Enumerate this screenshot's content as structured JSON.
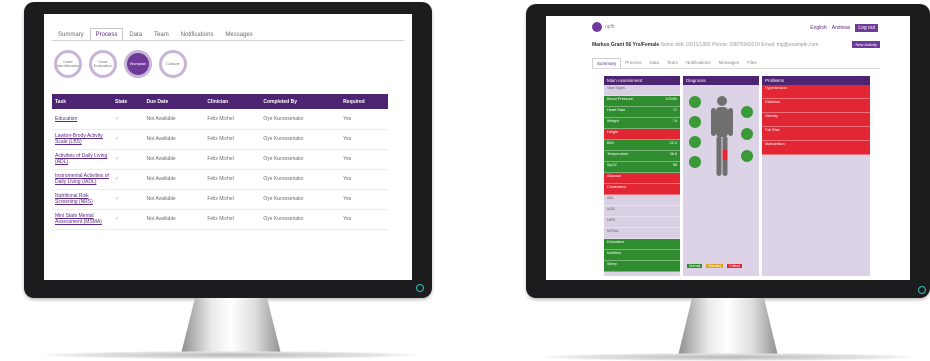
{
  "left_screen": {
    "tabs": [
      {
        "label": "Summary",
        "active": false
      },
      {
        "label": "Process",
        "active": true
      },
      {
        "label": "Data",
        "active": false
      },
      {
        "label": "Team",
        "active": false
      },
      {
        "label": "Notifications",
        "active": false
      },
      {
        "label": "Messages",
        "active": false
      }
    ],
    "steps": [
      {
        "label": "Case identification",
        "active": false
      },
      {
        "label": "Case Evaluation",
        "active": false
      },
      {
        "label": "Workplan",
        "active": true
      },
      {
        "label": "Closure",
        "active": false
      }
    ],
    "table": {
      "headers": [
        "Task",
        "State",
        "Due Date",
        "Clinician",
        "Completed By",
        "Required"
      ],
      "rows": [
        [
          "Education",
          "✓",
          "Not Available",
          "Felix Michel",
          "Oye Kuroosenako",
          "Yes"
        ],
        [
          "Lawton-Brody Activity Scale (LBS)",
          "✓",
          "Not Available",
          "Felix Michel",
          "Oye Kuroosenako",
          "Yes"
        ],
        [
          "Activities of Daily Living (ADL)",
          "✓",
          "Not Available",
          "Felix Michel",
          "Oye Kuroosenako",
          "Yes"
        ],
        [
          "Instrumental Activities of Daily Living (IADL)",
          "✓",
          "Not Available",
          "Felix Michel",
          "Oye Kuroosenako",
          "Yes"
        ],
        [
          "Nutritional Risk Screening (NRS)",
          "✓",
          "Not Available",
          "Felix Michel",
          "Oye Kuroosenako",
          "Yes"
        ],
        [
          "Mini State Mental Assessment (MSMA)",
          "✓",
          "Not Available",
          "Felix Michel",
          "Oye Kuroosenako",
          "Yes"
        ]
      ]
    }
  },
  "right_screen": {
    "logo_text": "upfit",
    "nav": {
      "lang": "English",
      "user": "Andreas",
      "logout": "Log out"
    },
    "patient": {
      "name": "Markus Grant",
      "id": "56 Yrs/Female",
      "details": "Some dob: 03/11/1956 Phone: 09876543210 Email: mg@example.com"
    },
    "button": "New Activity",
    "tabs": [
      {
        "label": "Summary",
        "active": true
      },
      {
        "label": "Process",
        "active": false
      },
      {
        "label": "Data",
        "active": false
      },
      {
        "label": "Team",
        "active": false
      },
      {
        "label": "Notifications",
        "active": false
      },
      {
        "label": "Messages",
        "active": false
      },
      {
        "label": "Files",
        "active": false
      }
    ],
    "panels": {
      "assessment": {
        "title": "Main Assessment",
        "cells": [
          {
            "label": "Vital Signs",
            "value": "",
            "color": "lav"
          },
          {
            "label": "Blood Pressure",
            "value": "120/80",
            "color": "green"
          },
          {
            "label": "Heart Rate",
            "value": "72",
            "color": "green"
          },
          {
            "label": "Weight",
            "value": "74",
            "color": "green"
          },
          {
            "label": "Height",
            "value": "",
            "color": "red"
          },
          {
            "label": "BMI",
            "value": "22.4",
            "color": "green"
          },
          {
            "label": "Temperature",
            "value": "36.6",
            "color": "green"
          },
          {
            "label": "SpO2",
            "value": "98",
            "color": "green"
          },
          {
            "label": "Glucose",
            "value": "",
            "color": "red"
          },
          {
            "label": "Cholesterol",
            "value": "",
            "color": "red"
          },
          {
            "label": "ADL",
            "value": "",
            "color": "lav"
          },
          {
            "label": "IADL",
            "value": "",
            "color": "lav"
          },
          {
            "label": "NRS",
            "value": "",
            "color": "lav"
          },
          {
            "label": "MSMA",
            "value": "",
            "color": "lav"
          },
          {
            "label": "Education",
            "value": "",
            "color": "green"
          },
          {
            "label": "Nutrition",
            "value": "",
            "color": "green"
          },
          {
            "label": "Sleep",
            "value": "",
            "color": "green"
          }
        ]
      },
      "diagnosis": {
        "title": "Diagnosis"
      },
      "problems": {
        "title": "Problems",
        "cells": [
          {
            "label": "Hypertension",
            "value": "",
            "color": "red"
          },
          {
            "label": "Diabetes",
            "value": "",
            "color": "red"
          },
          {
            "label": "Obesity",
            "value": "",
            "color": "red"
          },
          {
            "label": "Fall Risk",
            "value": "",
            "color": "red"
          },
          {
            "label": "Malnutrition",
            "value": "",
            "color": "red"
          }
        ]
      }
    },
    "legend": [
      "Normal",
      "Warning",
      "Critical"
    ],
    "colors": {
      "brand": "#4d2472",
      "good": "#2f8c2f",
      "bad": "#e22633",
      "panel": "#ddd3e6"
    }
  }
}
